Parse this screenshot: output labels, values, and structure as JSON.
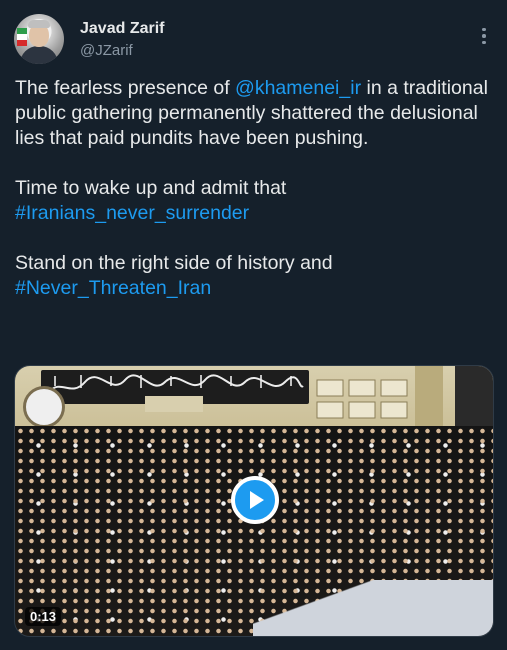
{
  "author": {
    "name": "Javad Zarif",
    "handle": "@JZarif"
  },
  "icons": {
    "more": "more-vertical-icon",
    "play": "play-icon"
  },
  "colors": {
    "background": "#15202b",
    "link": "#1d9bf0",
    "text": "#e7e9ea",
    "secondary": "#8b98a5"
  },
  "tweet": {
    "p1_before": "The fearless presence of ",
    "p1_mention": "@khamenei_ir",
    "p1_after": " in a traditional public gathering permanently shattered the delusional lies that paid pundits have been pushing.",
    "p2_text": "Time to wake up and admit that",
    "p2_hashtag": "#Iranians_never_surrender",
    "p3_text": "Stand on the right side of history and",
    "p3_hashtag": "#Never_Threaten_Iran"
  },
  "video": {
    "duration": "0:13"
  }
}
